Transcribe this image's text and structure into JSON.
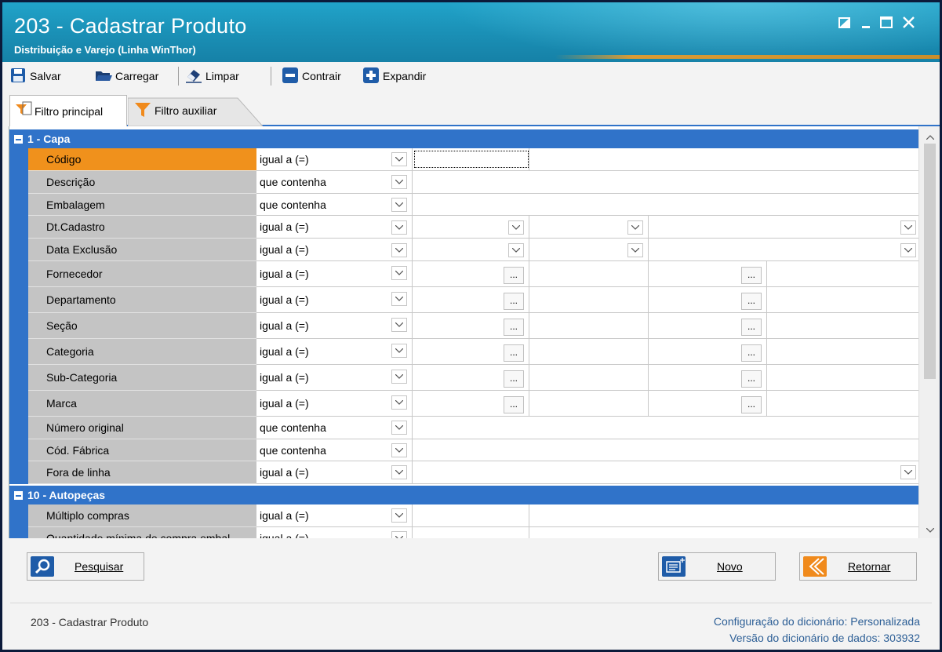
{
  "window": {
    "title": "203 - Cadastrar  Produto",
    "subtitle": "Distribuição e Varejo (Linha WinThor)",
    "controls": [
      "restore-icon",
      "minimize-icon",
      "maximize-icon",
      "close-icon"
    ]
  },
  "toolbar": {
    "save_label": "Salvar",
    "load_label": "Carregar",
    "clear_label": "Limpar",
    "collapse_label": "Contrair",
    "expand_label": "Expandir"
  },
  "tabs": [
    {
      "label": "Filtro principal",
      "active": true
    },
    {
      "label": "Filtro auxiliar",
      "active": false
    }
  ],
  "groups": [
    {
      "label": "1 - Capa"
    },
    {
      "label": "10 - Autopeças"
    }
  ],
  "rows": [
    {
      "label": "Código",
      "operator": "igual a (=)",
      "selected": true
    },
    {
      "label": "Descrição",
      "operator": "que contenha"
    },
    {
      "label": "Embalagem",
      "operator": "que contenha"
    },
    {
      "label": "Dt.Cadastro",
      "operator": "igual a (=)"
    },
    {
      "label": "Data Exclusão",
      "operator": "igual a (=)"
    },
    {
      "label": "Fornecedor",
      "operator": "igual a (=)"
    },
    {
      "label": "Departamento",
      "operator": "igual a (=)"
    },
    {
      "label": "Seção",
      "operator": "igual a (=)"
    },
    {
      "label": "Categoria",
      "operator": "igual a (=)"
    },
    {
      "label": "Sub-Categoria",
      "operator": "igual a (=)"
    },
    {
      "label": "Marca",
      "operator": "igual a (=)"
    },
    {
      "label": "Número original",
      "operator": "que contenha"
    },
    {
      "label": "Cód. Fábrica",
      "operator": "que contenha"
    },
    {
      "label": "Fora de linha",
      "operator": "igual a (=)"
    },
    {
      "label": "Múltiplo compras",
      "operator": "igual a (=)"
    },
    {
      "label": "Quantidade mínima de compra embal",
      "operator": "igual a (=)"
    }
  ],
  "ellipsis_label": "...",
  "buttons": {
    "search_label": "Pesquisar",
    "new_label": "Novo",
    "back_label": "Retornar"
  },
  "status": {
    "left": "203 - Cadastrar  Produto",
    "dict_config_key": "Configuração do dicionário:",
    "dict_config_val": "Personalizada",
    "dict_version_key": "Versão do dicionário de dados:",
    "dict_version_val": "303932"
  },
  "colors": {
    "titlebar": "#1a8fb5",
    "group_header": "#3073c9",
    "selected_label": "#f0911c",
    "label_bg": "#c4c4c4"
  }
}
